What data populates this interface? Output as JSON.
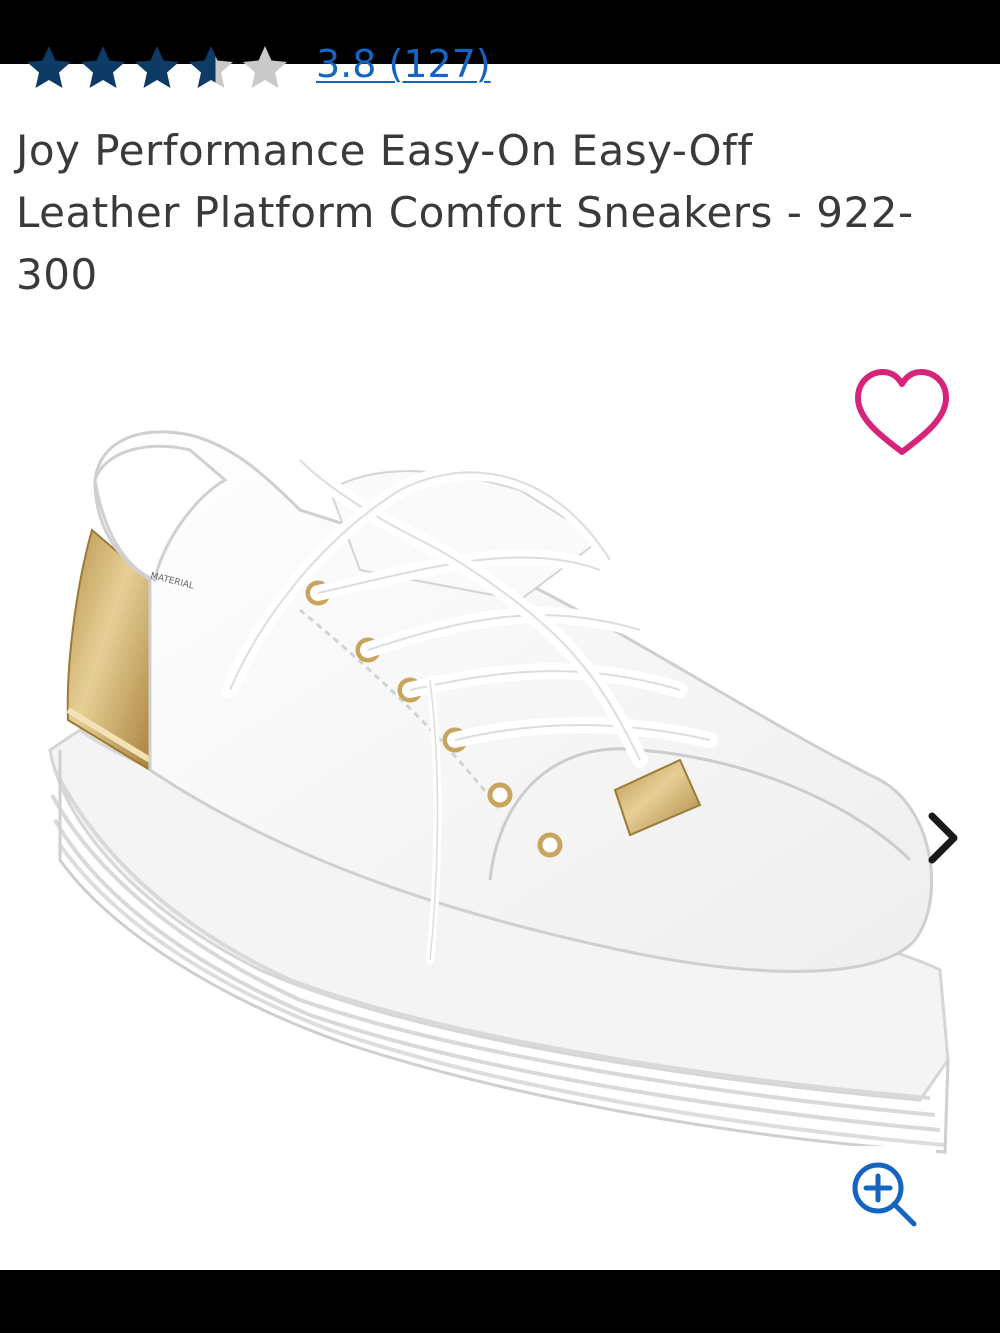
{
  "rating": {
    "text": "3.8 (127)",
    "value": 3.8,
    "max": 5,
    "star_color": "#0d3b66",
    "empty_star_color": "#c9c9c9",
    "link_color": "#1565c0"
  },
  "product": {
    "title": "Joy Performance Easy-On Easy-Off Leather Platform Comfort Sneakers - 922-300"
  },
  "image": {
    "insole_text": "MATERIAL"
  },
  "icons": {
    "wishlist": "heart-icon",
    "next": "chevron-right-icon",
    "zoom": "zoom-in-icon"
  },
  "colors": {
    "wishlist_pink": "#d6247a",
    "zoom_blue": "#1565c0",
    "gold": "#c9a45c"
  }
}
